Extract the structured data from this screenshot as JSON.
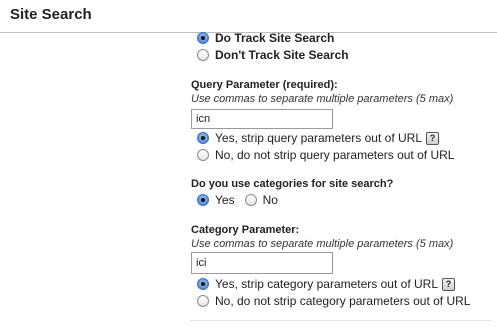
{
  "header": {
    "title": "Site Search"
  },
  "tracking": {
    "do_track_label": "Do Track Site Search",
    "dont_track_label": "Don't Track Site Search",
    "selected": "do_track"
  },
  "query_param": {
    "label": "Query Parameter (required):",
    "hint": "Use commas to separate multiple parameters (5 max)",
    "value": "icn",
    "strip_yes_label": "Yes, strip query parameters out of URL",
    "strip_no_label": "No, do not strip query parameters out of URL",
    "strip_selected": "yes",
    "help_glyph": "?"
  },
  "categories": {
    "label": "Do you use categories for site search?",
    "yes_label": "Yes",
    "no_label": "No",
    "selected": "yes"
  },
  "category_param": {
    "label": "Category Parameter:",
    "hint": "Use commas to separate multiple parameters (5 max)",
    "value": "ici",
    "strip_yes_label": "Yes, strip category parameters out of URL",
    "strip_no_label": "No, do not strip category parameters out of URL",
    "strip_selected": "yes",
    "help_glyph": "?"
  }
}
